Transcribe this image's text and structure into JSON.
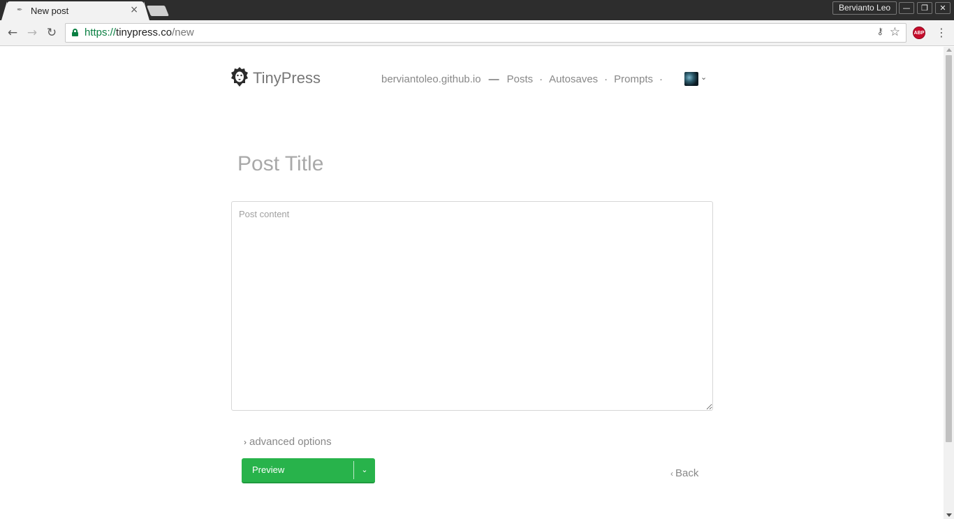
{
  "browser": {
    "tab_title": "New post",
    "tab_close": "×",
    "profile_name": "Bervianto Leo",
    "window_buttons": {
      "minimize": "—",
      "restore": "❐",
      "close": "✕"
    },
    "nav": {
      "back": "←",
      "forward": "→",
      "reload": "↻"
    },
    "url": {
      "scheme": "https://",
      "host": "tinypress.co",
      "path": "/new"
    },
    "star": "☆",
    "key": "⚷",
    "abp_label": "ABP",
    "menu": "⋮",
    "icons": {
      "lock": "lock-icon",
      "abp": "adblock-icon",
      "favicon": "quill-icon"
    },
    "colors": {
      "secure_green": "#0b8043",
      "abp_red": "#c70d2c"
    }
  },
  "header": {
    "brand": "TinyPress",
    "site_link": "berviantoleo.github.io",
    "dash": "—",
    "links": [
      "Posts",
      "Autosaves",
      "Prompts"
    ],
    "dot": "·",
    "avatar_caret": "⌄"
  },
  "editor": {
    "title_placeholder": "Post Title",
    "content_placeholder": "Post content",
    "advanced_options": "advanced options",
    "chevron_right": "›"
  },
  "actions": {
    "preview_label": "Preview",
    "caret": "⌄",
    "back_label": "Back",
    "chevron_left": "‹",
    "colors": {
      "button_green": "#28b34b"
    }
  }
}
